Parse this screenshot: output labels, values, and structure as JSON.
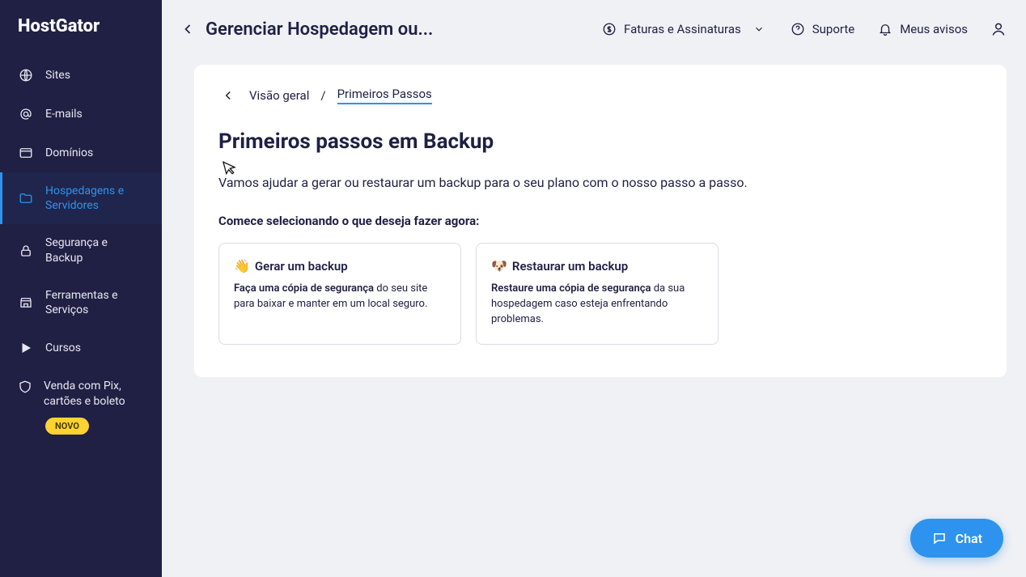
{
  "brand": "HostGator",
  "sidebar": {
    "items": [
      {
        "label": "Sites"
      },
      {
        "label": "E-mails"
      },
      {
        "label": "Domínios"
      },
      {
        "label": "Hospedagens e Servidores"
      },
      {
        "label": "Segurança e Backup"
      },
      {
        "label": "Ferramentas e Serviços"
      },
      {
        "label": "Cursos"
      }
    ],
    "promo": {
      "label": "Venda com Pix, cartões e boleto",
      "badge": "NOVO"
    }
  },
  "topbar": {
    "title": "Gerenciar Hospedagem ou...",
    "invoices": "Faturas e Assinaturas",
    "support": "Suporte",
    "notices": "Meus avisos"
  },
  "breadcrumb": {
    "overview": "Visão geral",
    "current": "Primeiros Passos"
  },
  "page": {
    "title": "Primeiros passos em Backup",
    "lead": "Vamos ajudar a gerar ou restaurar um backup para o seu plano com o nosso passo a passo.",
    "subhead": "Comece selecionando o que deseja fazer agora:"
  },
  "cards": {
    "generate": {
      "emoji": "👋",
      "title": "Gerar um backup",
      "desc_bold": "Faça uma cópia de segurança",
      "desc_rest": " do seu site para baixar e manter em um local seguro."
    },
    "restore": {
      "emoji": "🐶",
      "title": "Restaurar um backup",
      "desc_bold": "Restaure uma cópia de segurança",
      "desc_rest": " da sua hospedagem caso esteja enfrentando problemas."
    }
  },
  "chat": {
    "label": "Chat"
  }
}
